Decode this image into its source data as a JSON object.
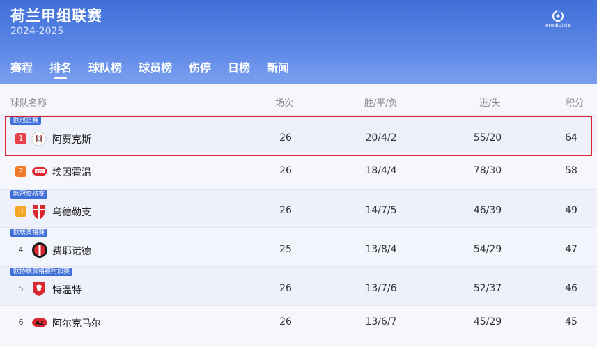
{
  "header": {
    "title": "荷兰甲组联赛",
    "season": "2024-2025",
    "logo_text": "eredivisie"
  },
  "tabs": [
    {
      "label": "赛程",
      "active": false
    },
    {
      "label": "排名",
      "active": true
    },
    {
      "label": "球队榜",
      "active": false
    },
    {
      "label": "球员榜",
      "active": false
    },
    {
      "label": "伤停",
      "active": false
    },
    {
      "label": "日榜",
      "active": false
    },
    {
      "label": "新闻",
      "active": false
    }
  ],
  "columns": {
    "team": "球队名称",
    "played": "场次",
    "wdl": "胜/平/负",
    "goals": "进/失",
    "points": "积分"
  },
  "rows": [
    {
      "tag": "欧冠正赛",
      "rank": "1",
      "rank_color": "#e8414a",
      "badge": "ajax-badge-icon",
      "team": "阿贾克斯",
      "played": "26",
      "wdl": "20/4/2",
      "goals": "55/20",
      "points": "64"
    },
    {
      "tag": "",
      "rank": "2",
      "rank_color": "#f07a2a",
      "badge": "psv-badge-icon",
      "team": "埃因霍温",
      "played": "26",
      "wdl": "18/4/4",
      "goals": "78/30",
      "points": "58"
    },
    {
      "tag": "欧冠资格赛",
      "rank": "3",
      "rank_color": "#f2a623",
      "badge": "utrecht-badge-icon",
      "team": "乌德勒支",
      "played": "26",
      "wdl": "14/7/5",
      "goals": "46/39",
      "points": "49"
    },
    {
      "tag": "欧联资格赛",
      "rank": "4",
      "rank_color": "",
      "badge": "feyenoord-badge-icon",
      "team": "费耶诺德",
      "played": "25",
      "wdl": "13/8/4",
      "goals": "54/29",
      "points": "47"
    },
    {
      "tag": "欧协联资格赛附加赛",
      "rank": "5",
      "rank_color": "",
      "badge": "twente-badge-icon",
      "team": "特温特",
      "played": "26",
      "wdl": "13/7/6",
      "goals": "52/37",
      "points": "46"
    },
    {
      "tag": "",
      "rank": "6",
      "rank_color": "",
      "badge": "az-badge-icon",
      "team": "阿尔克马尔",
      "played": "26",
      "wdl": "13/6/7",
      "goals": "45/29",
      "points": "45"
    }
  ]
}
